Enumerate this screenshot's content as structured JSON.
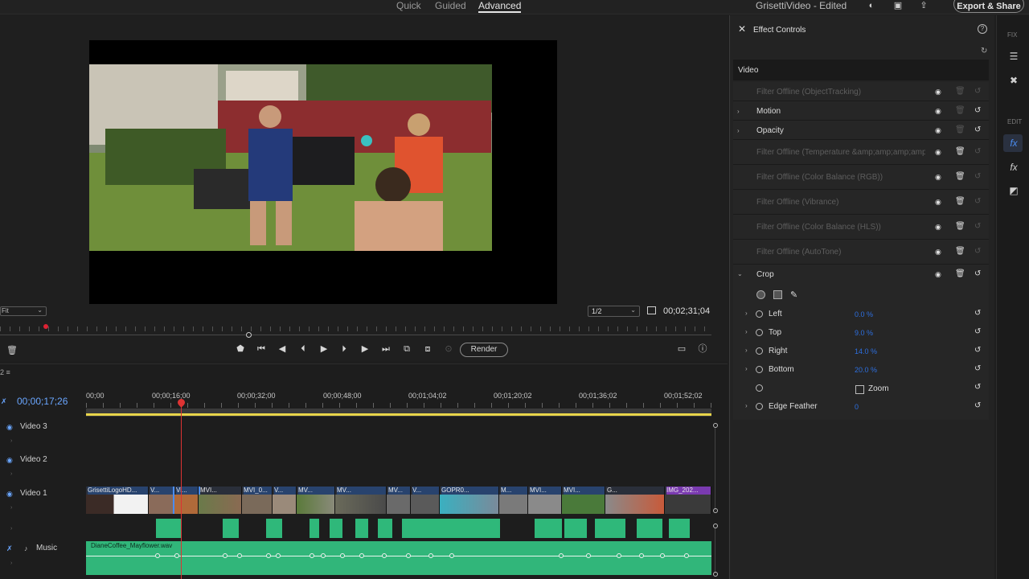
{
  "topbar": {
    "modes": [
      "Quick",
      "Guided",
      "Advanced"
    ],
    "active_mode": "Advanced",
    "project_title": "GrisettiVideo - Edited",
    "export_label": "Export & Share"
  },
  "monitor": {
    "fit_value": "Fit",
    "resolution_value": "1/2",
    "duration": "00;02;31;04",
    "render_label": "Render"
  },
  "timeline": {
    "current_time": "00;00;17;26",
    "ruler": [
      "00;00",
      "00;00;16;00",
      "00;00;32;00",
      "00;00;48;00",
      "00;01;04;02",
      "00;01;20;02",
      "00;01;36;02",
      "00;01;52;02"
    ],
    "tracks": {
      "video3": "Video 3",
      "video2": "Video 2",
      "video1": "Video 1",
      "music": "Music"
    },
    "clips": [
      "GrisettiLogoHD...",
      "V...",
      "Vi...",
      "MVI...",
      "MVI_0...",
      "V...",
      "MV...",
      "MV...",
      "MV...",
      "V...",
      "GOPR0...",
      "M...",
      "MVI...",
      "MVI...",
      "G...",
      "IMG_202..."
    ],
    "music_clip": "DianeCoffee_Mayflower.wav"
  },
  "effect_controls": {
    "title": "Effect Controls",
    "section": "Video",
    "effects": [
      {
        "name": "Filter Offline (ObjectTracking)",
        "offline": true,
        "expandable": false
      },
      {
        "name": "Motion",
        "offline": false,
        "expandable": true
      },
      {
        "name": "Opacity",
        "offline": false,
        "expandable": true
      },
      {
        "name": "Filter Offline (Temperature &amp;amp;amp;amp;amp;amp;",
        "offline": true,
        "expandable": false
      },
      {
        "name": "Filter Offline (Color Balance (RGB))",
        "offline": true,
        "expandable": false
      },
      {
        "name": "Filter Offline (Vibrance)",
        "offline": true,
        "expandable": false
      },
      {
        "name": "Filter Offline (Color Balance (HLS))",
        "offline": true,
        "expandable": false
      },
      {
        "name": "Filter Offline (AutoTone)",
        "offline": true,
        "expandable": false
      },
      {
        "name": "Crop",
        "offline": false,
        "expandable": true
      }
    ],
    "crop": {
      "left": {
        "label": "Left",
        "value": "0.0 %"
      },
      "top": {
        "label": "Top",
        "value": "9.0 %"
      },
      "right": {
        "label": "Right",
        "value": "14.0 %"
      },
      "bottom": {
        "label": "Bottom",
        "value": "20.0 %"
      },
      "zoom_label": "Zoom",
      "edge_feather": {
        "label": "Edge Feather",
        "value": "0"
      }
    }
  },
  "rail": {
    "fix_label": "FIX",
    "edit_label": "EDIT"
  },
  "colors": {
    "accent_blue": "#4a8cf0",
    "audio_green": "#31b67a",
    "playhead_red": "#dd3333",
    "work_area_yellow": "#e8d44a"
  }
}
